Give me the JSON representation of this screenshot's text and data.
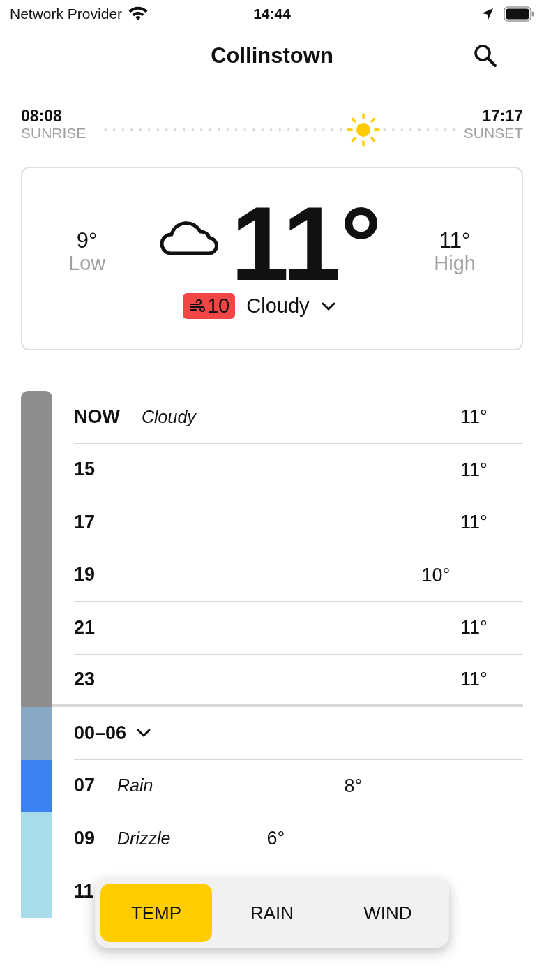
{
  "status_bar": {
    "carrier": "Network Provider",
    "time": "14:44"
  },
  "header": {
    "title": "Collinstown"
  },
  "sun": {
    "sunrise_time": "08:08",
    "sunrise_label": "SUNRISE",
    "sunset_time": "17:17",
    "sunset_label": "SUNSET",
    "level": 0.74
  },
  "current": {
    "low": "9°",
    "low_label": "Low",
    "temp": "11°",
    "high": "11°",
    "high_label": "High",
    "wind": "10",
    "condition": "Cloudy"
  },
  "hours": [
    {
      "kind": "hour",
      "hour": "NOW",
      "condition": "Cloudy",
      "temp": "11°",
      "color": "#8e8e8e"
    },
    {
      "kind": "hour",
      "hour": "15",
      "temp": "11°",
      "color": "#8e8e8e"
    },
    {
      "kind": "hour",
      "hour": "17",
      "temp": "11°",
      "color": "#8e8e8e"
    },
    {
      "kind": "hour",
      "hour": "19",
      "temp": "10°",
      "color": "#8e8e8e"
    },
    {
      "kind": "hour",
      "hour": "21",
      "temp": "11°",
      "color": "#8e8e8e"
    },
    {
      "kind": "hour",
      "hour": "23",
      "temp": "11°",
      "color": "#8e8e8e"
    },
    {
      "kind": "group",
      "hour": "00–06",
      "expanded": false,
      "color": "#88a8c4"
    },
    {
      "kind": "hour",
      "hour": "07",
      "condition": "Rain",
      "temp": "8°",
      "color": "#3c82f0"
    },
    {
      "kind": "hour",
      "hour": "09",
      "condition": "Drizzle",
      "temp": "6°",
      "color": "#a8dcea"
    },
    {
      "kind": "hour",
      "hour": "11",
      "color": "#a8dcea"
    }
  ],
  "tabs": [
    {
      "label": "TEMP",
      "selected": true
    },
    {
      "label": "RAIN",
      "selected": false
    },
    {
      "label": "WIND",
      "selected": false
    }
  ]
}
